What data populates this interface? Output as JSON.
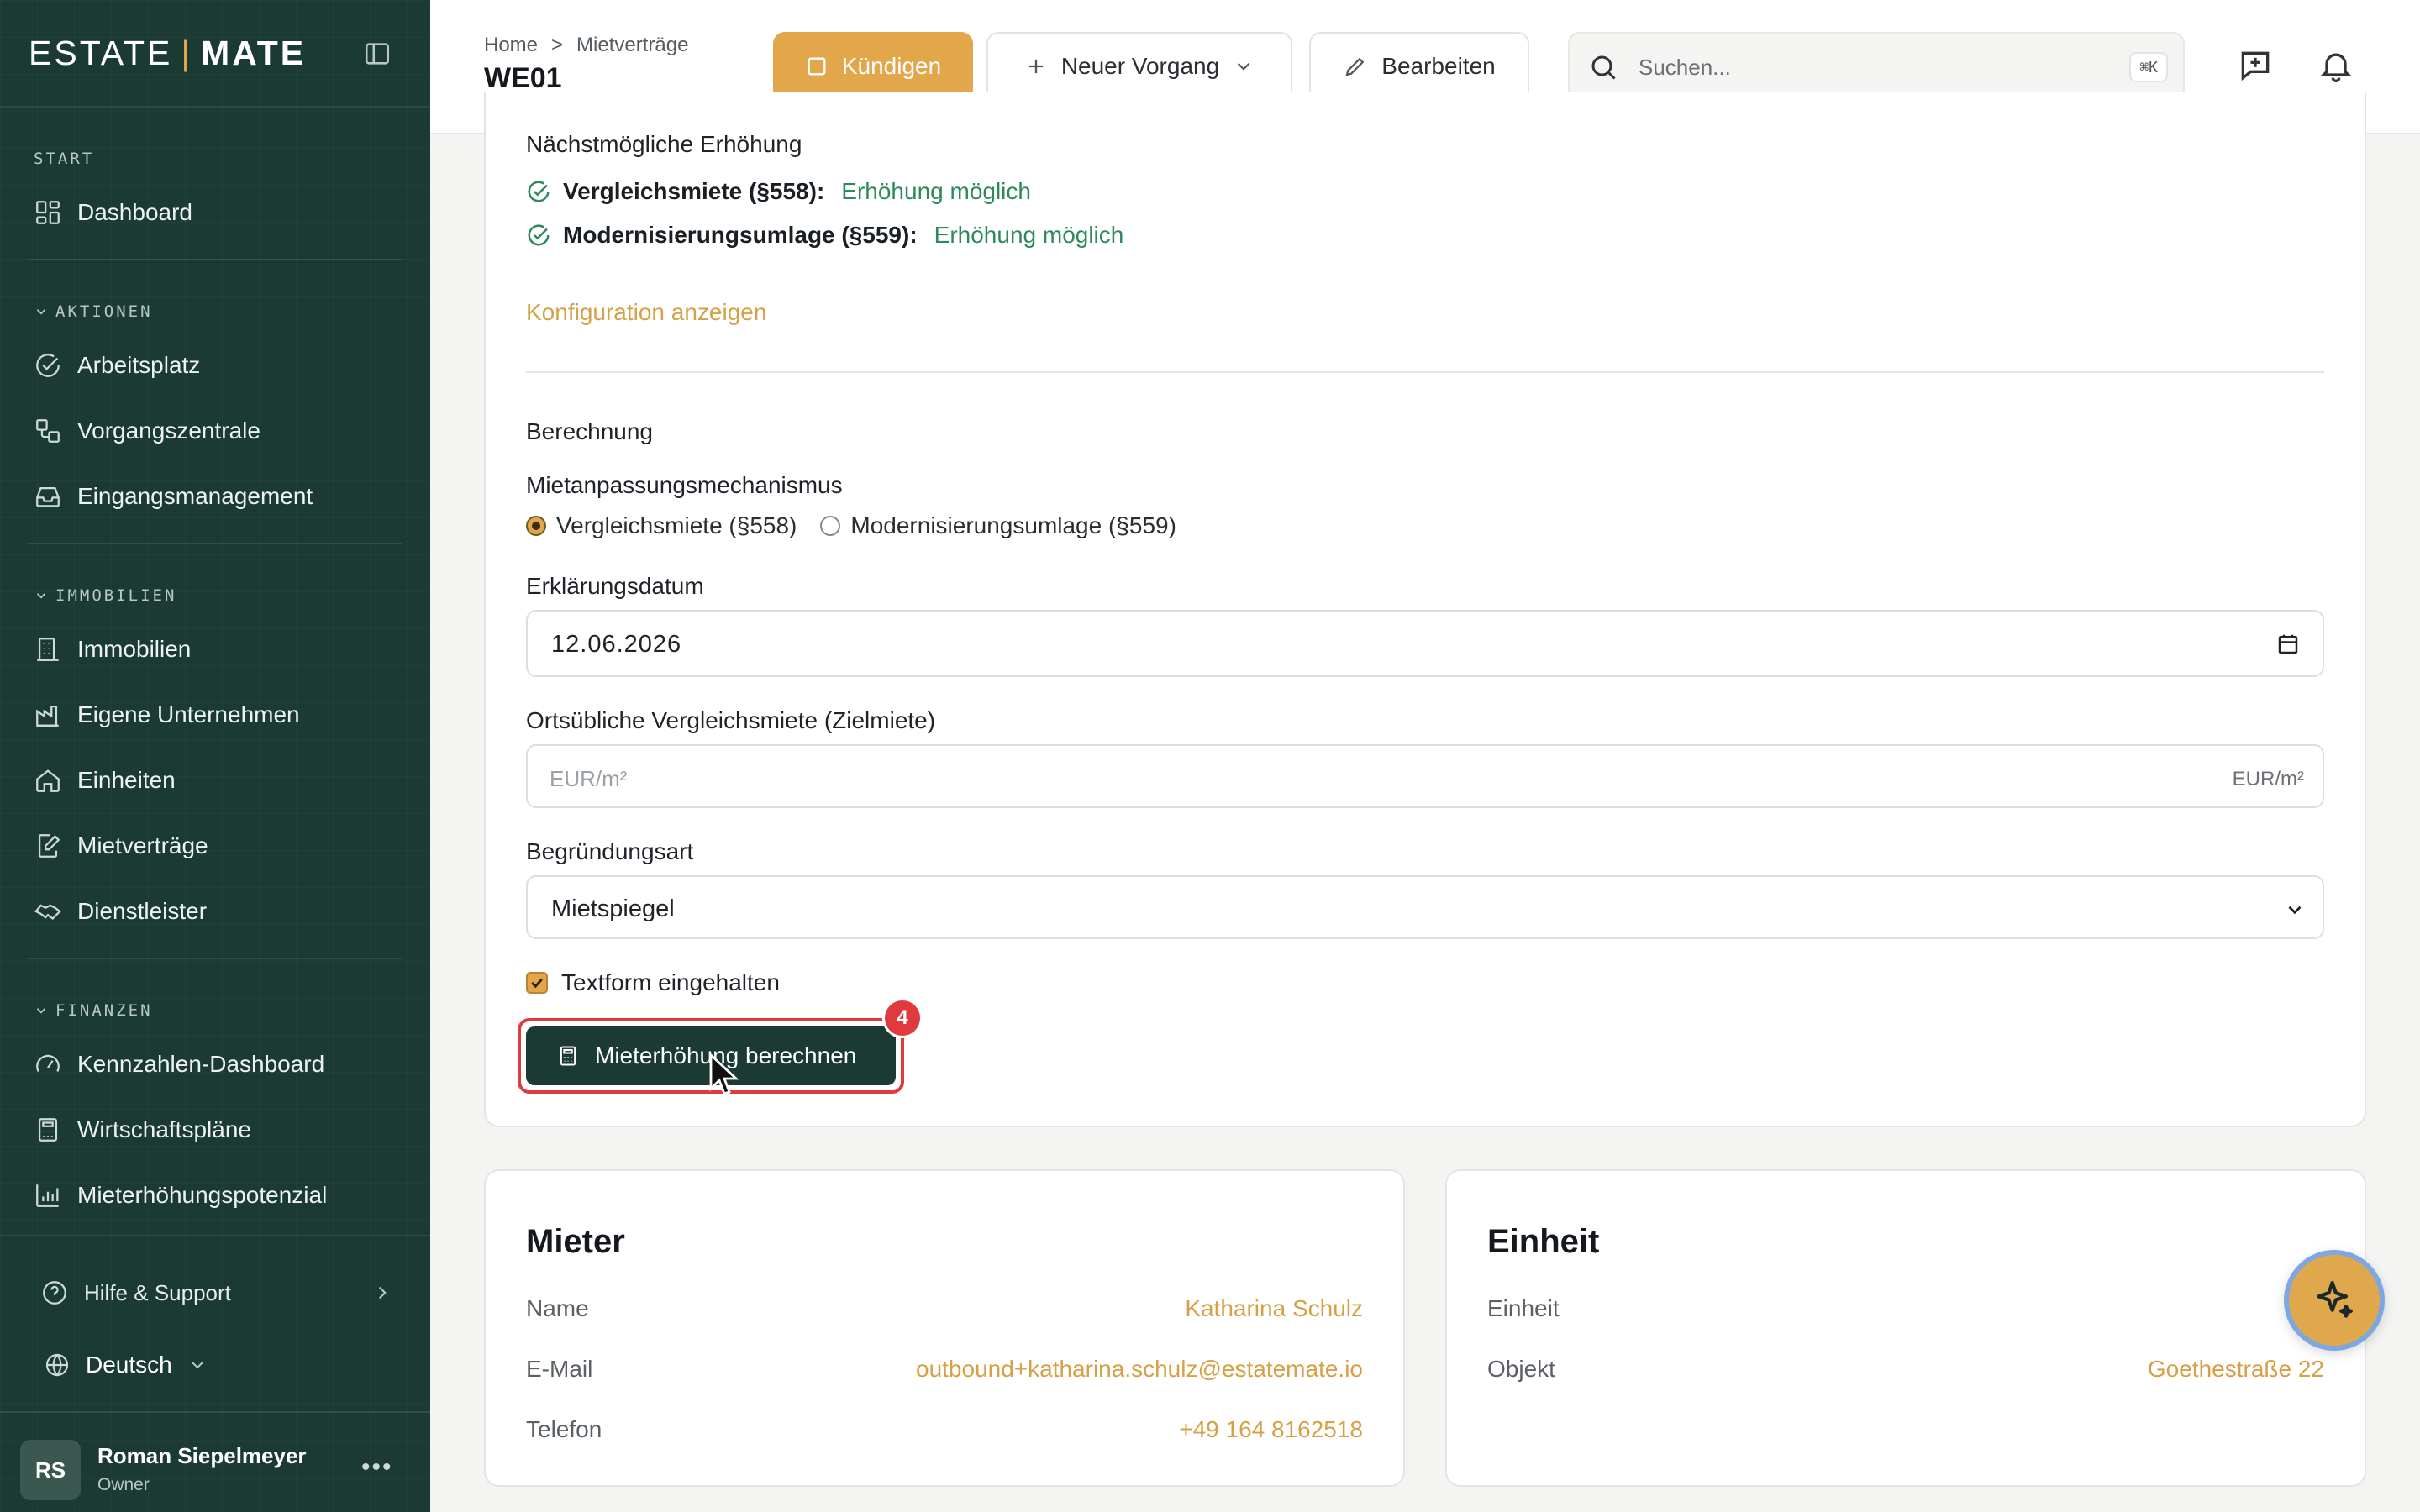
{
  "sidebar": {
    "logo_left": "ESTATE",
    "logo_sep": "|",
    "logo_right": "MATE",
    "sections": {
      "start": "START",
      "aktionen": "AKTIONEN",
      "immobilien": "IMMOBILIEN",
      "finanzen": "FINANZEN"
    },
    "items": {
      "dashboard": "Dashboard",
      "arbeitsplatz": "Arbeitsplatz",
      "vorgangszentrale": "Vorgangszentrale",
      "eingangsmanagement": "Eingangsmanagement",
      "immobilien": "Immobilien",
      "unternehmen": "Eigene Unternehmen",
      "einheiten": "Einheiten",
      "mietvertraege": "Mietverträge",
      "dienstleister": "Dienstleister",
      "kennzahlen": "Kennzahlen-Dashboard",
      "wirtschaftsplaene": "Wirtschaftspläne",
      "mieterhoehung": "Mieterhöhungspotenzial"
    },
    "help": "Hilfe & Support",
    "language": "Deutsch",
    "user": {
      "initials": "RS",
      "name": "Roman Siepelmeyer",
      "role": "Owner"
    }
  },
  "header": {
    "breadcrumb_home": "Home",
    "breadcrumb_sep": ">",
    "breadcrumb_current": "Mietverträge",
    "title": "WE01",
    "btn_kuendigen": "Kündigen",
    "btn_neu": "Neuer Vorgang",
    "btn_edit": "Bearbeiten",
    "search_placeholder": "Suchen...",
    "search_shortcut": "⌘K"
  },
  "form": {
    "next_increase_title": "Nächstmögliche Erhöhung",
    "check1_label": "Vergleichsmiete (§558):",
    "check1_value": "Erhöhung möglich",
    "check2_label": "Modernisierungsumlage (§559):",
    "check2_value": "Erhöhung möglich",
    "config_link": "Konfiguration anzeigen",
    "berechnung": "Berechnung",
    "mechanism_label": "Mietanpassungsmechanismus",
    "radio1": "Vergleichsmiete (§558)",
    "radio2": "Modernisierungsumlage (§559)",
    "date_label": "Erklärungsdatum",
    "date_value": "12.06.2026",
    "target_rent_label": "Ortsübliche Vergleichsmiete (Zielmiete)",
    "target_rent_placeholder": "EUR/m²",
    "target_rent_unit": "EUR/m²",
    "reason_label": "Begründungsart",
    "reason_value": "Mietspiegel",
    "textform_label": "Textform eingehalten",
    "calc_button": "Mieterhöhung berechnen",
    "badge_count": "4"
  },
  "mieter": {
    "title": "Mieter",
    "name_label": "Name",
    "name_value": "Katharina Schulz",
    "email_label": "E-Mail",
    "email_value": "outbound+katharina.schulz@estatemate.io",
    "phone_label": "Telefon",
    "phone_value": "+49 164 8162518"
  },
  "einheit": {
    "title": "Einheit",
    "unit_label": "Einheit",
    "unit_value": "W",
    "object_label": "Objekt",
    "object_value": "Goethestraße 22"
  },
  "colors": {
    "sidebar_bg": "#1b3a33",
    "accent_gold": "#e2a64b",
    "success_green": "#2f8a5b",
    "danger_red": "#e0393e"
  }
}
